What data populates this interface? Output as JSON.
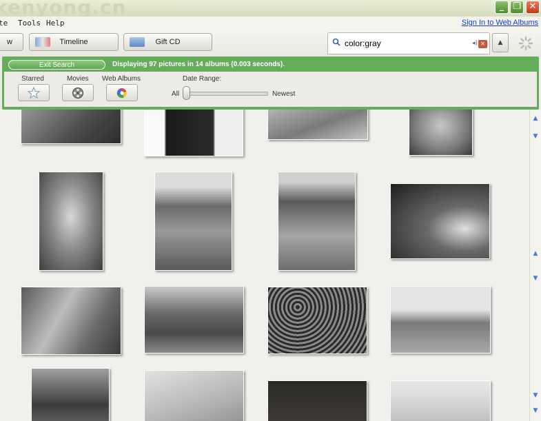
{
  "window": {
    "watermark": "kenyong.cn",
    "controls": [
      "_",
      "❐",
      "✕"
    ]
  },
  "menu": {
    "items": [
      {
        "label": "te"
      },
      {
        "label": "Tools"
      },
      {
        "label": "Help"
      }
    ],
    "signin_label": "Sign In to Web Albums"
  },
  "toolbar": {
    "partial_label": "w",
    "timeline_label": "Timeline",
    "giftcd_label": "Gift CD"
  },
  "search": {
    "value": "color:gray",
    "clear_label": "×",
    "collapse_label": "▲"
  },
  "results": {
    "exit_label": "Exit Search",
    "status": "Displaying 97 pictures in 14 albums (0.003 seconds)."
  },
  "filters": {
    "starred_label": "Starred",
    "movies_label": "Movies",
    "webalbums_label": "Web Albums",
    "daterange_label": "Date Range:",
    "all_label": "All",
    "newest_label": "Newest",
    "date_position": 0
  },
  "colors": {
    "accent_green": "#66ad5b",
    "link_blue": "#1a3cc2",
    "close_red": "#c2391b"
  },
  "photos": [
    {
      "name": "photo-rooftops",
      "tone": "#5a5a5a"
    },
    {
      "name": "photo-dark-jacket",
      "tone": "#1e1e1e"
    },
    {
      "name": "photo-road-walkers",
      "tone": "#9a9a9a"
    },
    {
      "name": "photo-bare-torso",
      "tone": "#7e7e7e"
    },
    {
      "name": "photo-fighter-closeup",
      "tone": "#6e6e6e"
    },
    {
      "name": "photo-fighter-standing",
      "tone": "#5f5f5f"
    },
    {
      "name": "photo-fighter-kick",
      "tone": "#6a6a6a"
    },
    {
      "name": "photo-boy-portrait",
      "tone": "#3a3a3a"
    },
    {
      "name": "photo-street-crowd",
      "tone": "#777777"
    },
    {
      "name": "photo-motorcycles",
      "tone": "#606060"
    },
    {
      "name": "photo-dense-crowd",
      "tone": "#505050"
    },
    {
      "name": "photo-street-performers",
      "tone": "#8c8c8c"
    },
    {
      "name": "photo-group-people",
      "tone": "#707070"
    },
    {
      "name": "photo-sketch",
      "tone": "#c2c2c2"
    },
    {
      "name": "photo-dark-scene",
      "tone": "#2c2a28"
    },
    {
      "name": "photo-branches",
      "tone": "#d2d2d2"
    }
  ]
}
